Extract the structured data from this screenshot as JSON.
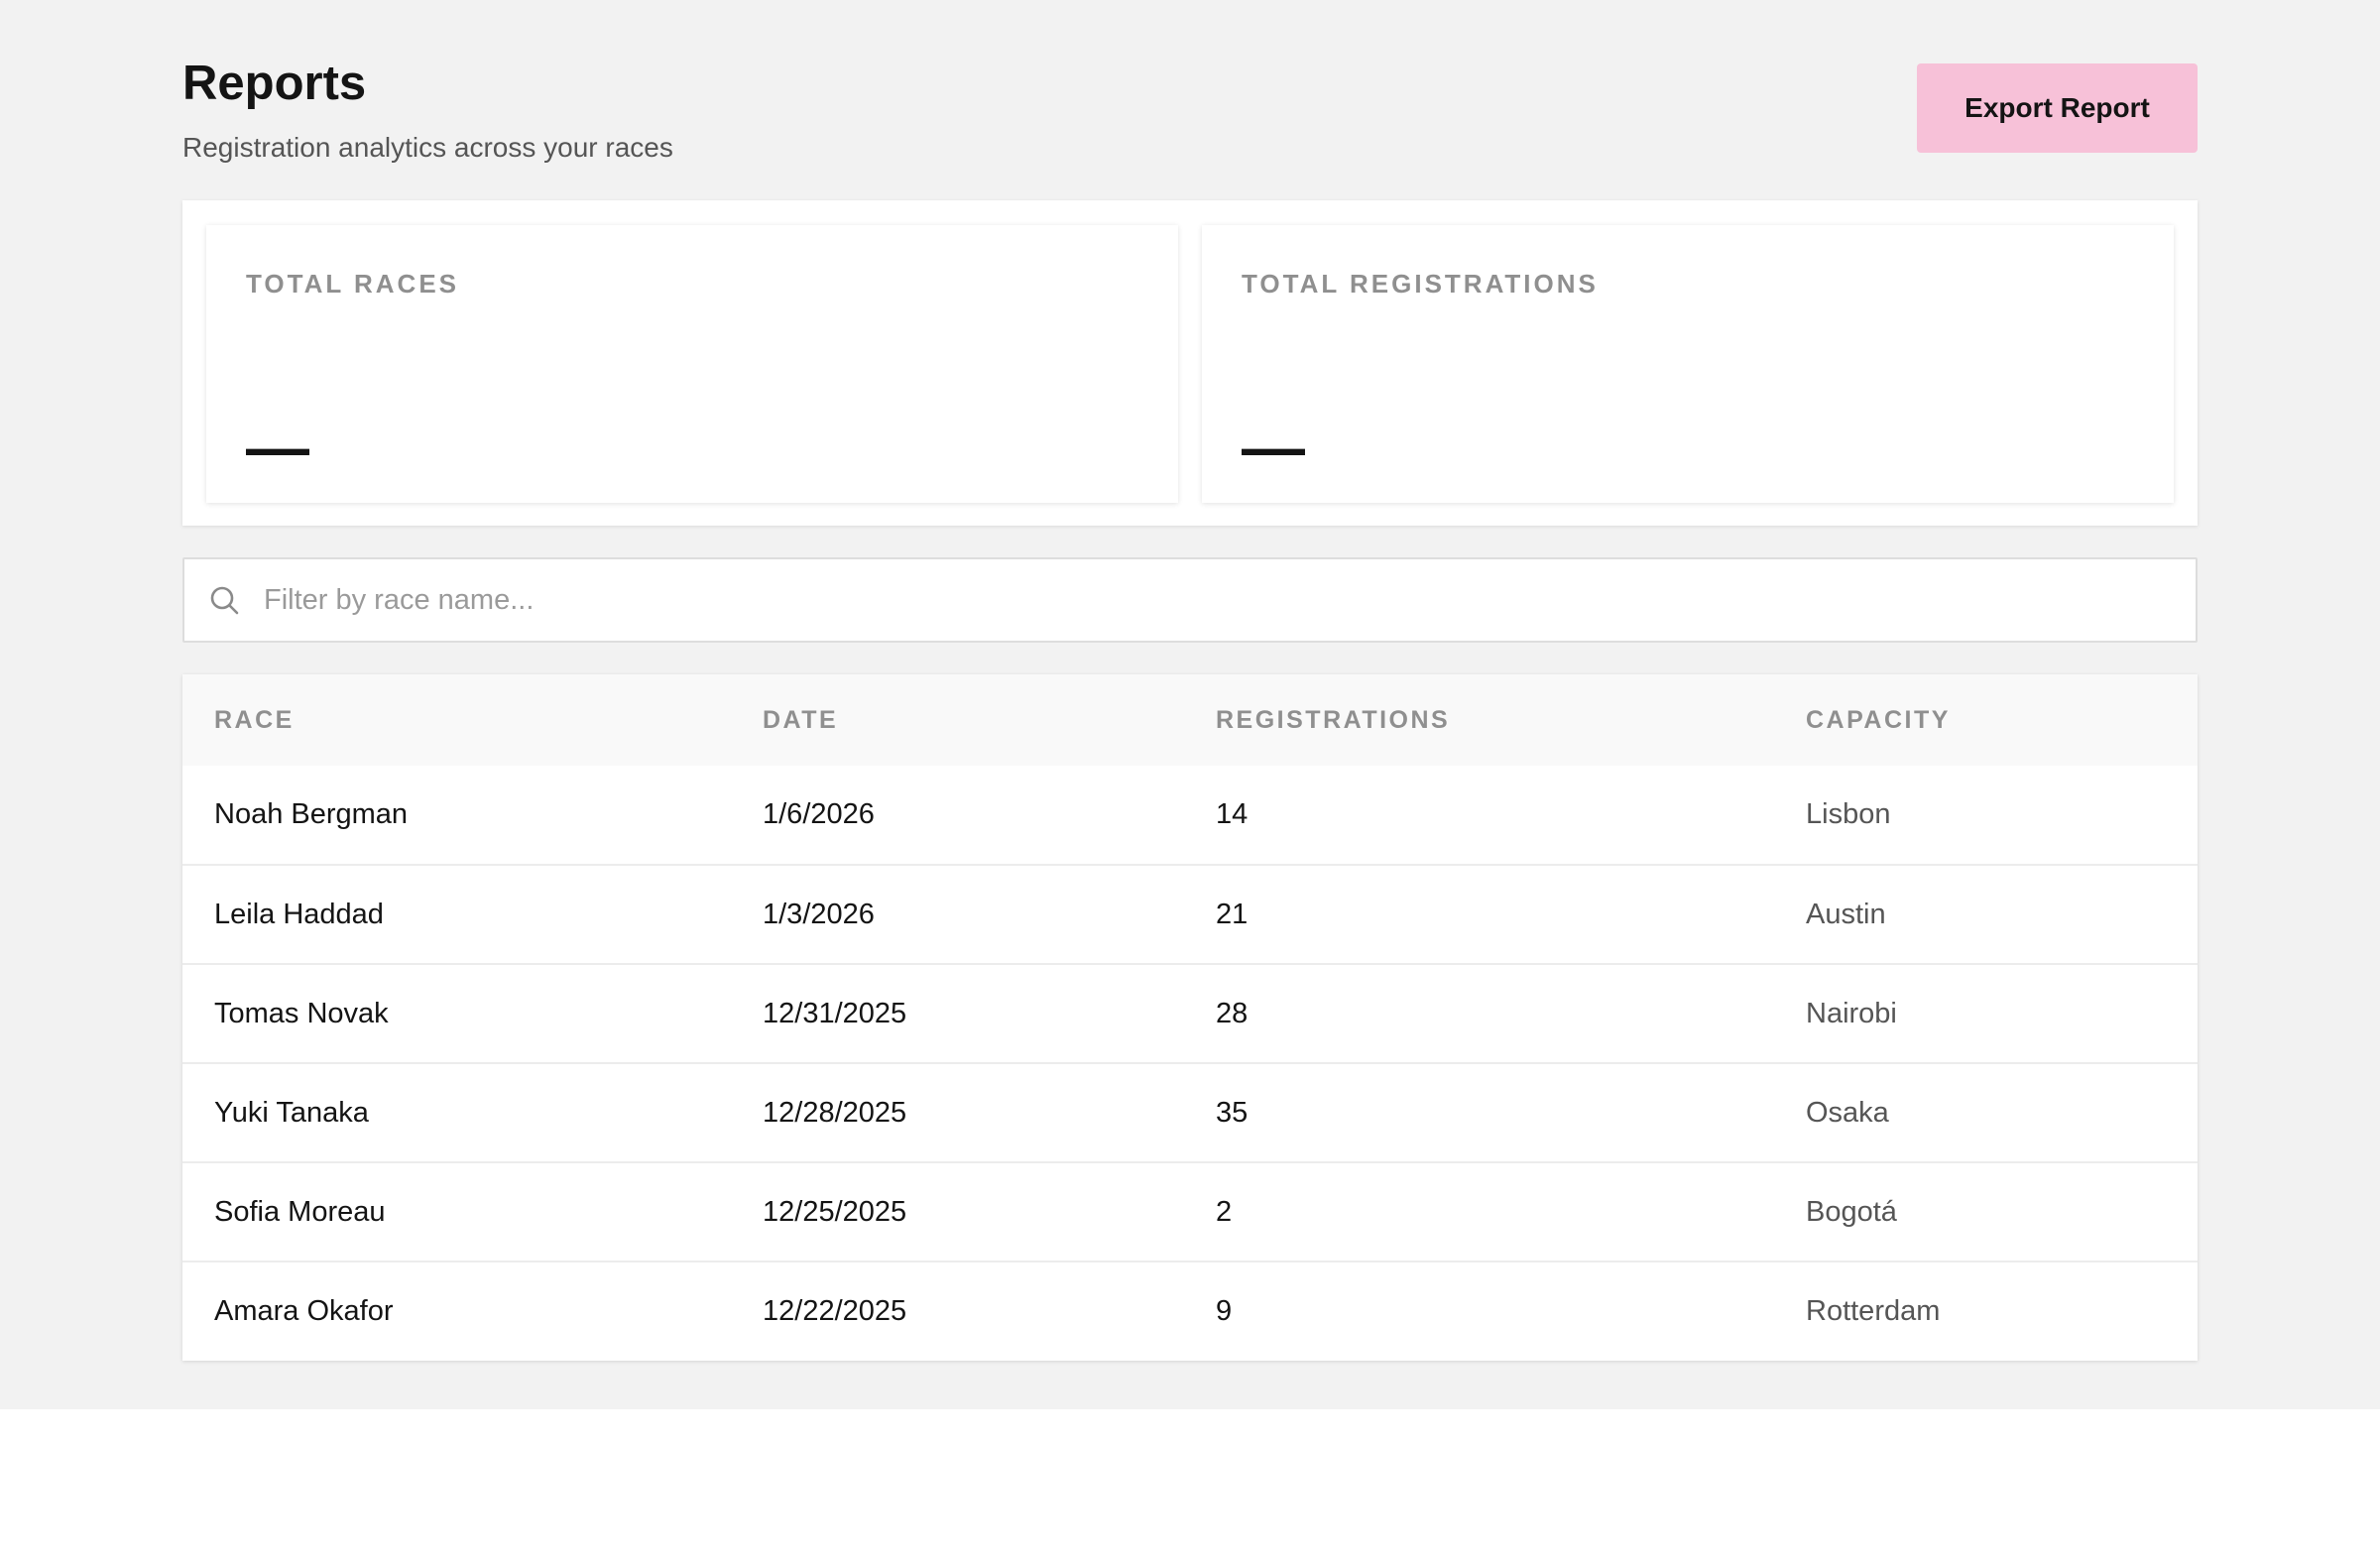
{
  "header": {
    "title": "Reports",
    "subtitle": "Registration analytics across your races",
    "export_label": "Export Report"
  },
  "stats": {
    "total_races": {
      "label": "TOTAL RACES",
      "value": "—"
    },
    "total_registrations": {
      "label": "TOTAL REGISTRATIONS",
      "value": "—"
    }
  },
  "search": {
    "placeholder": "Filter by race name...",
    "value": ""
  },
  "table": {
    "columns": [
      "RACE",
      "DATE",
      "REGISTRATIONS",
      "CAPACITY"
    ],
    "rows": [
      {
        "race": "Noah Bergman",
        "date": "1/6/2026",
        "registrations": "14",
        "capacity": "Lisbon"
      },
      {
        "race": "Leila Haddad",
        "date": "1/3/2026",
        "registrations": "21",
        "capacity": "Austin"
      },
      {
        "race": "Tomas Novak",
        "date": "12/31/2025",
        "registrations": "28",
        "capacity": "Nairobi"
      },
      {
        "race": "Yuki Tanaka",
        "date": "12/28/2025",
        "registrations": "35",
        "capacity": "Osaka"
      },
      {
        "race": "Sofia Moreau",
        "date": "12/25/2025",
        "registrations": "2",
        "capacity": "Bogotá"
      },
      {
        "race": "Amara Okafor",
        "date": "12/22/2025",
        "registrations": "9",
        "capacity": "Rotterdam"
      }
    ]
  },
  "colors": {
    "page_background": "#f2f2f2",
    "accent_button": "#f7c1d8",
    "muted_text": "#8f8f8f"
  },
  "icons": {
    "search": "search-icon"
  }
}
